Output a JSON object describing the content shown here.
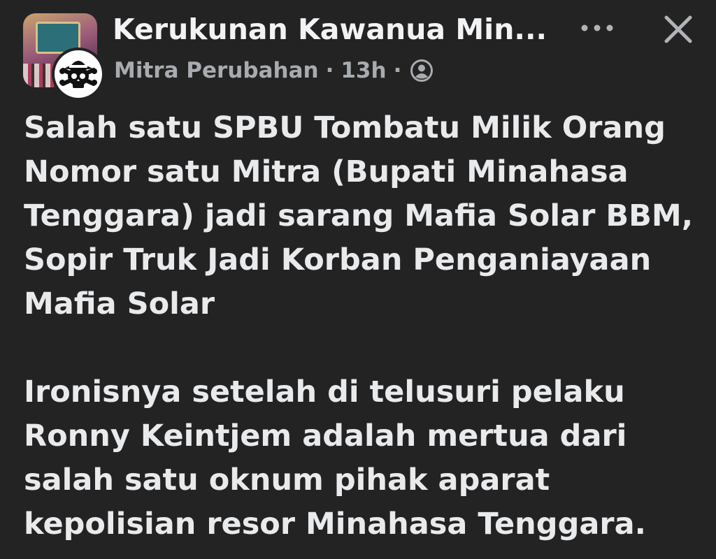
{
  "header": {
    "group_name": "Kerukunan Kawanua Min...",
    "author_name": "Mitra Perubahan",
    "separator": "·",
    "time": "13h",
    "audience_icon": "friends-audience-icon",
    "more_icon": "more-options-icon",
    "close_icon": "close-icon"
  },
  "post": {
    "paragraphs": [
      {
        "lines": [
          "Salah satu SPBU Tombatu Milik Orang",
          "Nomor satu Mitra (Bupati Minahasa",
          "Tenggara) jadi sarang Mafia Solar BBM,",
          "Sopir Truk Jadi Korban Penganiayaan",
          "Mafia Solar"
        ]
      },
      {
        "lines": [
          "Ironisnya setelah di telusuri pelaku",
          "Ronny Keintjem adalah mertua dari",
          "salah satu oknum pihak aparat",
          "kepolisian resor Minahasa Tenggara."
        ]
      }
    ]
  },
  "colors": {
    "background": "#232324",
    "primary_text": "#e9eaec",
    "secondary_text": "#a8abaf"
  }
}
